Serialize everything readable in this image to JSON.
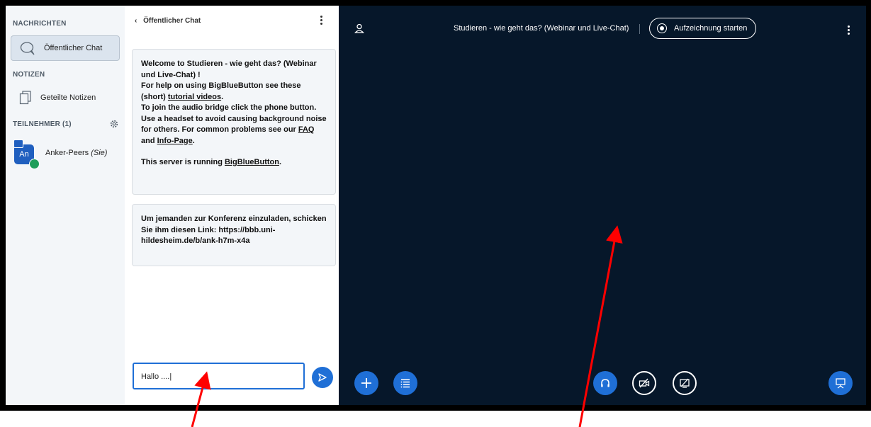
{
  "sidebar": {
    "messages_title": "NACHRICHTEN",
    "public_chat_label": "Öffentlicher Chat",
    "notes_title": "NOTIZEN",
    "shared_notes_label": "Geteilte Notizen",
    "participants_title": "TEILNEHMER (1)",
    "user": {
      "initials": "An",
      "name": "Anker-Peers",
      "you_suffix": "(Sie)"
    }
  },
  "chat": {
    "header_label": "Öffentlicher Chat",
    "welcome": {
      "part1": "Welcome to Studieren - wie geht das? (Webinar und Live-Chat) !",
      "part2": "For help on using BigBlueButton see these (short) ",
      "tutorial_link": "tutorial videos",
      "part3": ".",
      "part4": "To join the audio bridge click the phone button. Use a headset to avoid causing background noise for others. For common problems see our ",
      "faq_link": "FAQ",
      "and": " and ",
      "info_link": "Info-Page",
      "part5": ".",
      "server_text": "This server is running ",
      "bbb_link": "BigBlueButton",
      "end": "."
    },
    "invite": "Um jemanden zur Konferenz einzuladen, schicken Sie ihm diesen Link: https://bbb.uni-hildesheim.de/b/ank-h7m-x4a",
    "input_value": "Hallo ....|"
  },
  "main": {
    "title": "Studieren - wie geht das? (Webinar und Live-Chat)",
    "record_label": "Aufzeichnung starten"
  },
  "colors": {
    "accent": "#1f6fd6",
    "main_bg": "#06172a",
    "sidebar_bg": "#f3f6f9",
    "arrow": "#ff0000"
  }
}
